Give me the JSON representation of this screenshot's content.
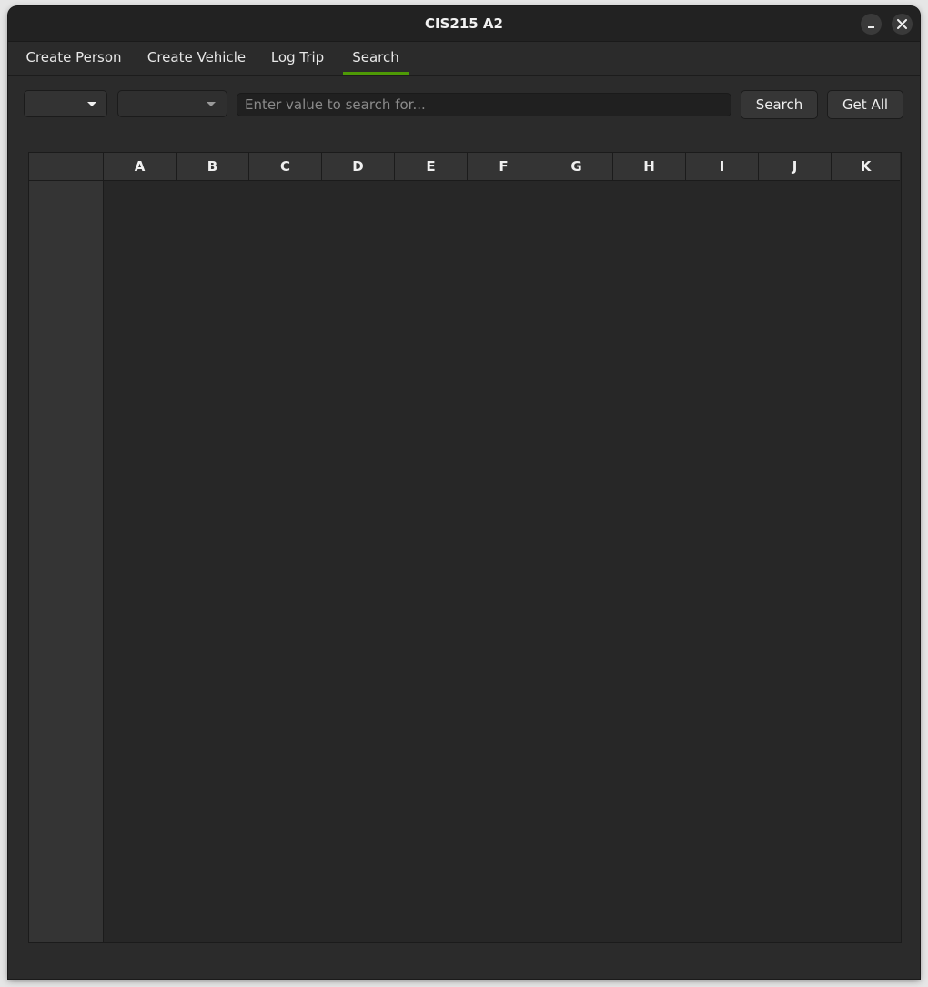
{
  "window": {
    "title": "CIS215 A2"
  },
  "tabs": [
    {
      "label": "Create Person"
    },
    {
      "label": "Create Vehicle"
    },
    {
      "label": "Log Trip"
    },
    {
      "label": "Search",
      "active": true
    }
  ],
  "search": {
    "placeholder": "Enter value to search for...",
    "value": "",
    "search_label": "Search",
    "get_all_label": "Get All"
  },
  "table": {
    "columns": [
      "A",
      "B",
      "C",
      "D",
      "E",
      "F",
      "G",
      "H",
      "I",
      "J",
      "K"
    ],
    "rows": []
  },
  "colors": {
    "accent": "#4e9a06"
  }
}
